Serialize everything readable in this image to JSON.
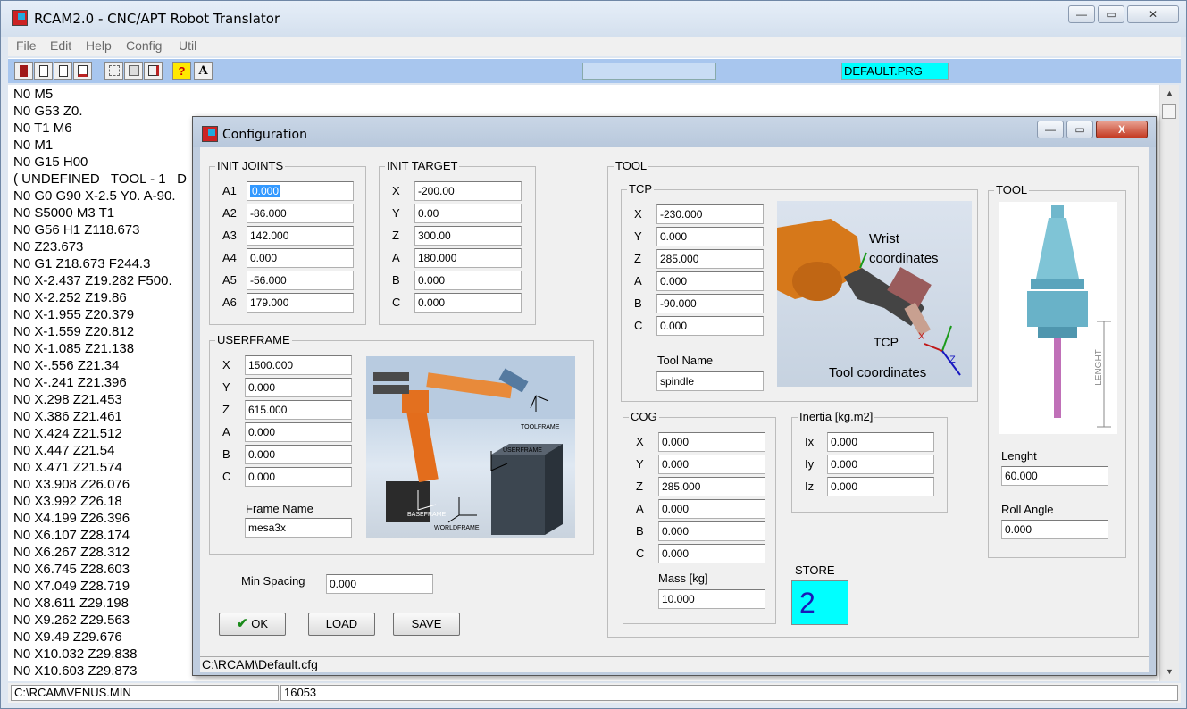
{
  "app": {
    "title": "RCAM2.0 - CNC/APT Robot Translator",
    "caption_buttons": [
      "—",
      "▭",
      "✕"
    ]
  },
  "menu": [
    "File",
    "Edit",
    "Help",
    "Config",
    "Util"
  ],
  "toolbar": {
    "help_glyph": "?",
    "font_glyph": "A",
    "program_field": "DEFAULT.PRG",
    "program_field_color": "#00ffff"
  },
  "editor": {
    "lines": [
      "N0 M5",
      "N0 G53 Z0.",
      "N0 T1 M6",
      "N0 M1",
      "N0 G15 H00",
      "( UNDEFINED   TOOL - 1   D",
      "N0 G0 G90 X-2.5 Y0. A-90.",
      "N0 S5000 M3 T1",
      "N0 G56 H1 Z118.673",
      "N0 Z23.673",
      "N0 G1 Z18.673 F244.3",
      "N0 X-2.437 Z19.282 F500.",
      "N0 X-2.252 Z19.86",
      "N0 X-1.955 Z20.379",
      "N0 X-1.559 Z20.812",
      "N0 X-1.085 Z21.138",
      "N0 X-.556 Z21.34",
      "N0 X-.241 Z21.396",
      "N0 X.298 Z21.453",
      "N0 X.386 Z21.461",
      "N0 X.424 Z21.512",
      "N0 X.447 Z21.54",
      "N0 X.471 Z21.574",
      "N0 X3.908 Z26.076",
      "N0 X3.992 Z26.18",
      "N0 X4.199 Z26.396",
      "N0 X6.107 Z28.174",
      "N0 X6.267 Z28.312",
      "N0 X6.745 Z28.603",
      "N0 X7.049 Z28.719",
      "N0 X8.611 Z29.198",
      "N0 X9.262 Z29.563",
      "N0 X9.49 Z29.676",
      "N0 X10.032 Z29.838",
      "N0 X10.603 Z29.873"
    ]
  },
  "statusbar": {
    "file": "C:\\RCAM\\VENUS.MIN",
    "count": "16053"
  },
  "dialog": {
    "title": "Configuration",
    "caption_buttons": [
      "—",
      "▭",
      "X"
    ],
    "status_path": "C:\\RCAM\\Default.cfg",
    "init_joints": {
      "label": "INIT JOINTS",
      "fields": [
        {
          "name": "A1",
          "value": "0.000"
        },
        {
          "name": "A2",
          "value": "-86.000"
        },
        {
          "name": "A3",
          "value": "142.000"
        },
        {
          "name": "A4",
          "value": "0.000"
        },
        {
          "name": "A5",
          "value": "-56.000"
        },
        {
          "name": "A6",
          "value": "179.000"
        }
      ]
    },
    "init_target": {
      "label": "INIT TARGET",
      "fields": [
        {
          "name": "X",
          "value": "-200.00"
        },
        {
          "name": "Y",
          "value": "0.00"
        },
        {
          "name": "Z",
          "value": "300.00"
        },
        {
          "name": "A",
          "value": "180.000"
        },
        {
          "name": "B",
          "value": "0.000"
        },
        {
          "name": "C",
          "value": "0.000"
        }
      ]
    },
    "userframe": {
      "label": "USERFRAME",
      "fields": [
        {
          "name": "X",
          "value": "1500.000"
        },
        {
          "name": "Y",
          "value": "0.000"
        },
        {
          "name": "Z",
          "value": "615.000"
        },
        {
          "name": "A",
          "value": "0.000"
        },
        {
          "name": "B",
          "value": "0.000"
        },
        {
          "name": "C",
          "value": "0.000"
        }
      ],
      "frame_name_label": "Frame Name",
      "frame_name": "mesa3x",
      "image_labels": {
        "toolframe": "TOOLFRAME",
        "userframe": "USERFRAME",
        "baseframe": "BASEFRAME",
        "worldframe": "WORLDFRAME"
      }
    },
    "min_spacing": {
      "label": "Min Spacing",
      "value": "0.000"
    },
    "buttons": {
      "ok": "OK",
      "load": "LOAD",
      "save": "SAVE"
    },
    "tool_group": {
      "label": "TOOL",
      "tcp": {
        "label": "TCP",
        "fields": [
          {
            "name": "X",
            "value": "-230.000"
          },
          {
            "name": "Y",
            "value": "0.000"
          },
          {
            "name": "Z",
            "value": "285.000"
          },
          {
            "name": "A",
            "value": "0.000"
          },
          {
            "name": "B",
            "value": "-90.000"
          },
          {
            "name": "C",
            "value": "0.000"
          }
        ],
        "tool_name_label": "Tool Name",
        "tool_name": "spindle",
        "image_labels": {
          "wrist": "Wrist",
          "wrist2": "coordinates",
          "tcp": "TCP",
          "tool": "Tool coordinates",
          "x": "X",
          "z": "Z"
        }
      },
      "cog": {
        "label": "COG",
        "fields": [
          {
            "name": "X",
            "value": "0.000"
          },
          {
            "name": "Y",
            "value": "0.000"
          },
          {
            "name": "Z",
            "value": "285.000"
          },
          {
            "name": "A",
            "value": "0.000"
          },
          {
            "name": "B",
            "value": "0.000"
          },
          {
            "name": "C",
            "value": "0.000"
          }
        ],
        "mass_label": "Mass [kg]",
        "mass": "10.000"
      },
      "inertia": {
        "label": "Inertia [kg.m2]",
        "fields": [
          {
            "name": "Ix",
            "value": "0.000"
          },
          {
            "name": "Iy",
            "value": "0.000"
          },
          {
            "name": "Iz",
            "value": "0.000"
          }
        ]
      },
      "store": {
        "label": "STORE",
        "value": "2",
        "color": "#00ffff"
      },
      "tool_panel": {
        "label": "TOOL",
        "image_text": "LENGHT",
        "length_label": "Lenght",
        "length": "60.000",
        "roll_label": "Roll Angle",
        "roll": "0.000"
      }
    }
  }
}
